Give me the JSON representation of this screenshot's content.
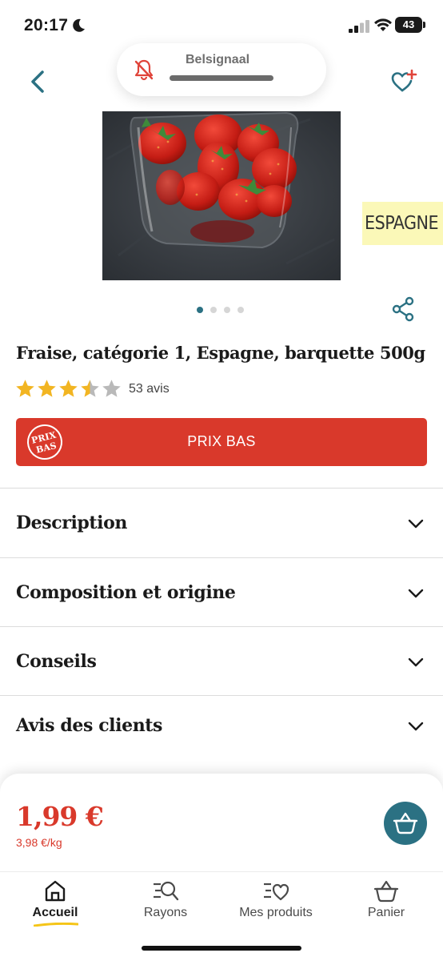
{
  "status_bar": {
    "time": "20:17",
    "battery": "43",
    "icons": [
      "moon-icon",
      "signal-icon",
      "wifi-icon",
      "battery-icon"
    ]
  },
  "header": {
    "notification": {
      "label": "Belsignaal",
      "icon": "bell-muted-icon"
    },
    "back_icon": "chevron-left-icon",
    "favorite_icon": "heart-plus-icon"
  },
  "product": {
    "image_alt": "strawberries-in-plastic-punnet",
    "origin_badge": "ESPAGNE",
    "carousel": {
      "count": 4,
      "active": 0
    },
    "title": "Fraise, catégorie 1, Espagne, barquette 500g",
    "rating": {
      "value": 3.5,
      "max": 5,
      "count_label": "53 avis"
    }
  },
  "promo": {
    "logo_line1": "PRIX",
    "logo_line2": "BAS",
    "label": "PRIX BAS"
  },
  "sections": [
    {
      "title": "Description"
    },
    {
      "title": "Composition et origine"
    },
    {
      "title": "Conseils"
    },
    {
      "title": "Avis des clients"
    }
  ],
  "price": {
    "main": "1,99 €",
    "per_unit": "3,98 €/kg"
  },
  "nav": {
    "items": [
      {
        "label": "Accueil",
        "icon": "home-icon",
        "active": true
      },
      {
        "label": "Rayons",
        "icon": "list-search-icon",
        "active": false
      },
      {
        "label": "Mes produits",
        "icon": "list-heart-icon",
        "active": false
      },
      {
        "label": "Panier",
        "icon": "basket-icon",
        "active": false
      }
    ]
  },
  "colors": {
    "accent": "#2b7183",
    "promo": "#d9392b",
    "star": "#f2b522",
    "underline": "#f5c518"
  }
}
